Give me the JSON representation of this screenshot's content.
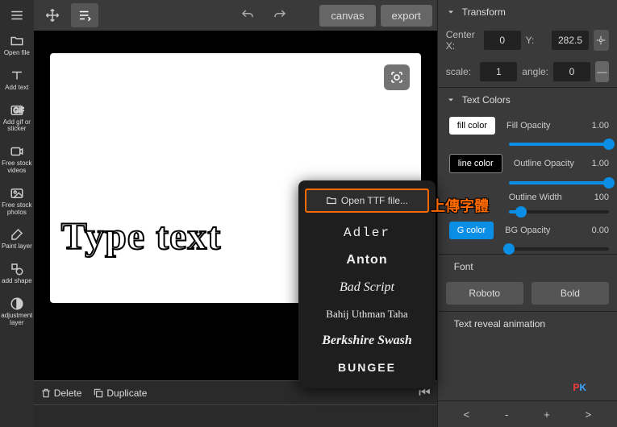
{
  "topbar": {
    "canvas_btn": "canvas",
    "export_btn": "export"
  },
  "leftbar": {
    "open_file": "Open file",
    "add_text": "Add text",
    "add_gif": "Add gif or sticker",
    "stock_videos": "Free stock videos",
    "stock_photos": "Free stock photos",
    "paint_layer": "Paint layer",
    "add_shape": "add shape",
    "adj_layer": "adjustment layer"
  },
  "canvas": {
    "type_text": "Type text"
  },
  "timeline": {
    "delete": "Delete",
    "duplicate": "Duplicate"
  },
  "right": {
    "transform": "Transform",
    "center_x_lab": "Center X:",
    "center_x_val": "0",
    "y_lab": "Y:",
    "y_val": "282.5",
    "scale_lab": "scale:",
    "scale_val": "1",
    "angle_lab": "angle:",
    "angle_val": "0",
    "text_colors": "Text Colors",
    "fill_color_btn": "fill color",
    "fill_opacity_lab": "Fill Opacity",
    "fill_opacity_val": "1.00",
    "line_color_btn": "line color",
    "outline_opacity_lab": "Outline Opacity",
    "outline_opacity_val": "1.00",
    "outline_width_lab": "Outline Width",
    "outline_width_val": "100",
    "bg_color_btn": "G color",
    "bg_opacity_lab": "BG Opacity",
    "bg_opacity_val": "0.00",
    "font_hdr": "Font",
    "font_btn": "Roboto",
    "bold_btn": "Bold",
    "reveal": "Text reveal animation",
    "nav_prev_far": "<",
    "nav_prev": "-",
    "nav_next": "+",
    "nav_next_far": ">"
  },
  "popup": {
    "open_ttf": "Open TTF file...",
    "fonts": [
      "Adler",
      "Anton",
      "Bad Script",
      "Bahij Uthman Taha",
      "Berkshire Swash",
      "BUNGEE"
    ]
  },
  "annotation": "上傳字體",
  "chart_data": null
}
